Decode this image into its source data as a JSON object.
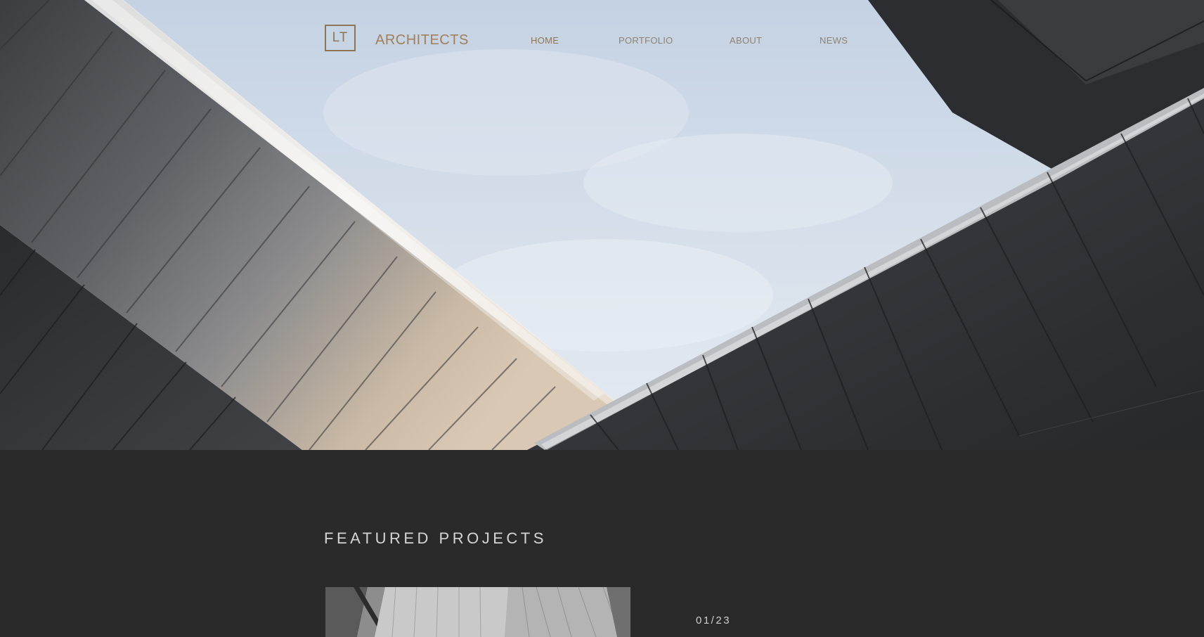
{
  "brand": {
    "logo_mark": "LT",
    "name": "ARCHITECTS"
  },
  "nav": {
    "items": [
      {
        "label": "HOME"
      },
      {
        "label": "PORTFOLIO"
      },
      {
        "label": "ABOUT"
      },
      {
        "label": "NEWS"
      }
    ]
  },
  "featured": {
    "title": "FEATURED PROJECTS",
    "counter": "01/23"
  },
  "colors": {
    "page_background": "#2a2a2a",
    "brand_accent": "#a07f5a",
    "nav_text": "#8f8272",
    "featured_text": "#d5d5d5"
  }
}
